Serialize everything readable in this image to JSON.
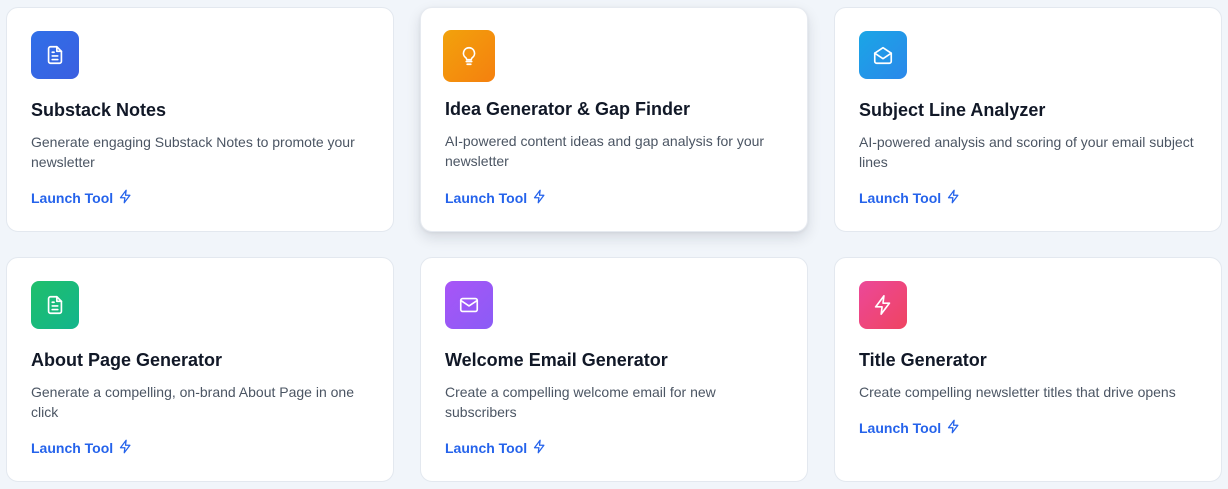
{
  "tools": [
    {
      "title": "Substack Notes",
      "description": "Generate engaging Substack Notes to promote your newsletter",
      "launch_label": "Launch Tool",
      "icon": "document-icon",
      "gradient": [
        "#2f6fe8",
        "#3b5fe0"
      ]
    },
    {
      "title": "Idea Generator & Gap Finder",
      "description": "AI-powered content ideas and gap analysis for your newsletter",
      "launch_label": "Launch Tool",
      "icon": "lightbulb-icon",
      "gradient": [
        "#f2a20c",
        "#f5800e"
      ]
    },
    {
      "title": "Subject Line Analyzer",
      "description": "AI-powered analysis and scoring of your email subject lines",
      "launch_label": "Launch Tool",
      "icon": "open-mail-icon",
      "gradient": [
        "#1aa6e6",
        "#2b88ea"
      ]
    },
    {
      "title": "About Page Generator",
      "description": "Generate a compelling, on-brand About Page in one click",
      "launch_label": "Launch Tool",
      "icon": "document-icon",
      "gradient": [
        "#1fbf6b",
        "#13b58c"
      ]
    },
    {
      "title": "Welcome Email Generator",
      "description": "Create a compelling welcome email for new subscribers",
      "launch_label": "Launch Tool",
      "icon": "mail-icon",
      "gradient": [
        "#a855f7",
        "#8b5cf6"
      ]
    },
    {
      "title": "Title Generator",
      "description": "Create compelling newsletter titles that drive opens",
      "launch_label": "Launch Tool",
      "icon": "lightning-icon",
      "gradient": [
        "#ec4899",
        "#ef4461"
      ]
    }
  ],
  "colors": {
    "accent_link": "#2563eb",
    "page_background": "#f1f5fa"
  }
}
